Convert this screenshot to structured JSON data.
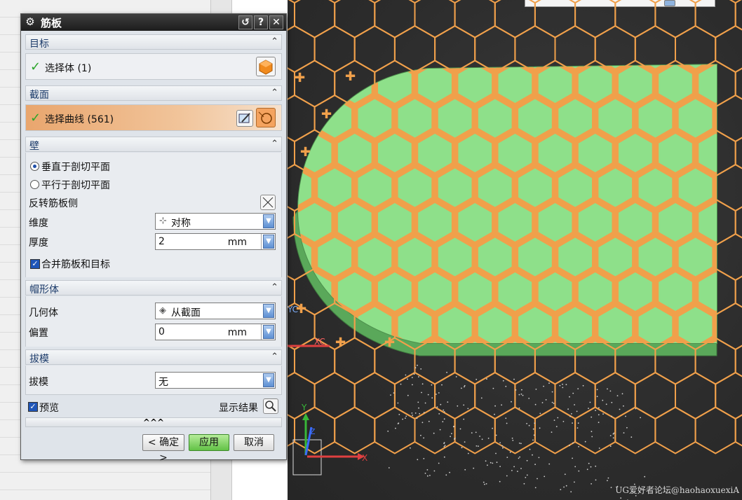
{
  "dialog": {
    "title": "筋板",
    "sections": {
      "target": {
        "title": "目标",
        "select_label": "选择体 (1)"
      },
      "section": {
        "title": "截面",
        "select_label": "选择曲线 (561)"
      },
      "wall": {
        "title": "壁",
        "radio_perp": "垂直于剖切平面",
        "radio_parallel": "平行于剖切平面",
        "reverse_label": "反转筋板侧",
        "dimension_label": "维度",
        "dimension_value": "对称",
        "thickness_label": "厚度",
        "thickness_value": "2",
        "thickness_unit": "mm",
        "merge_label": "合并筋板和目标",
        "merge_checked": true
      },
      "cap": {
        "title": "帽形体",
        "geometry_label": "几何体",
        "geometry_value": "从截面",
        "offset_label": "偏置",
        "offset_value": "0",
        "offset_unit": "mm"
      },
      "draft": {
        "title": "拔模",
        "draft_label": "拔模",
        "draft_value": "无"
      }
    },
    "preview_label": "预览",
    "show_result_label": "显示结果",
    "collapse_glyph": "^^^",
    "buttons": {
      "ok": "< 确定 >",
      "apply": "应用",
      "cancel": "取消"
    }
  },
  "viewport": {
    "watermark": "UG爱好者论坛@haohaoxuexiA",
    "axis_xc": "XC",
    "axis_yc": "YC",
    "triad_x": "X",
    "triad_y": "Y",
    "triad_z": "Z",
    "colors": {
      "plate": "#7fd67f",
      "hex_rib": "#f0a04b",
      "background": "#2b2b2b"
    }
  }
}
